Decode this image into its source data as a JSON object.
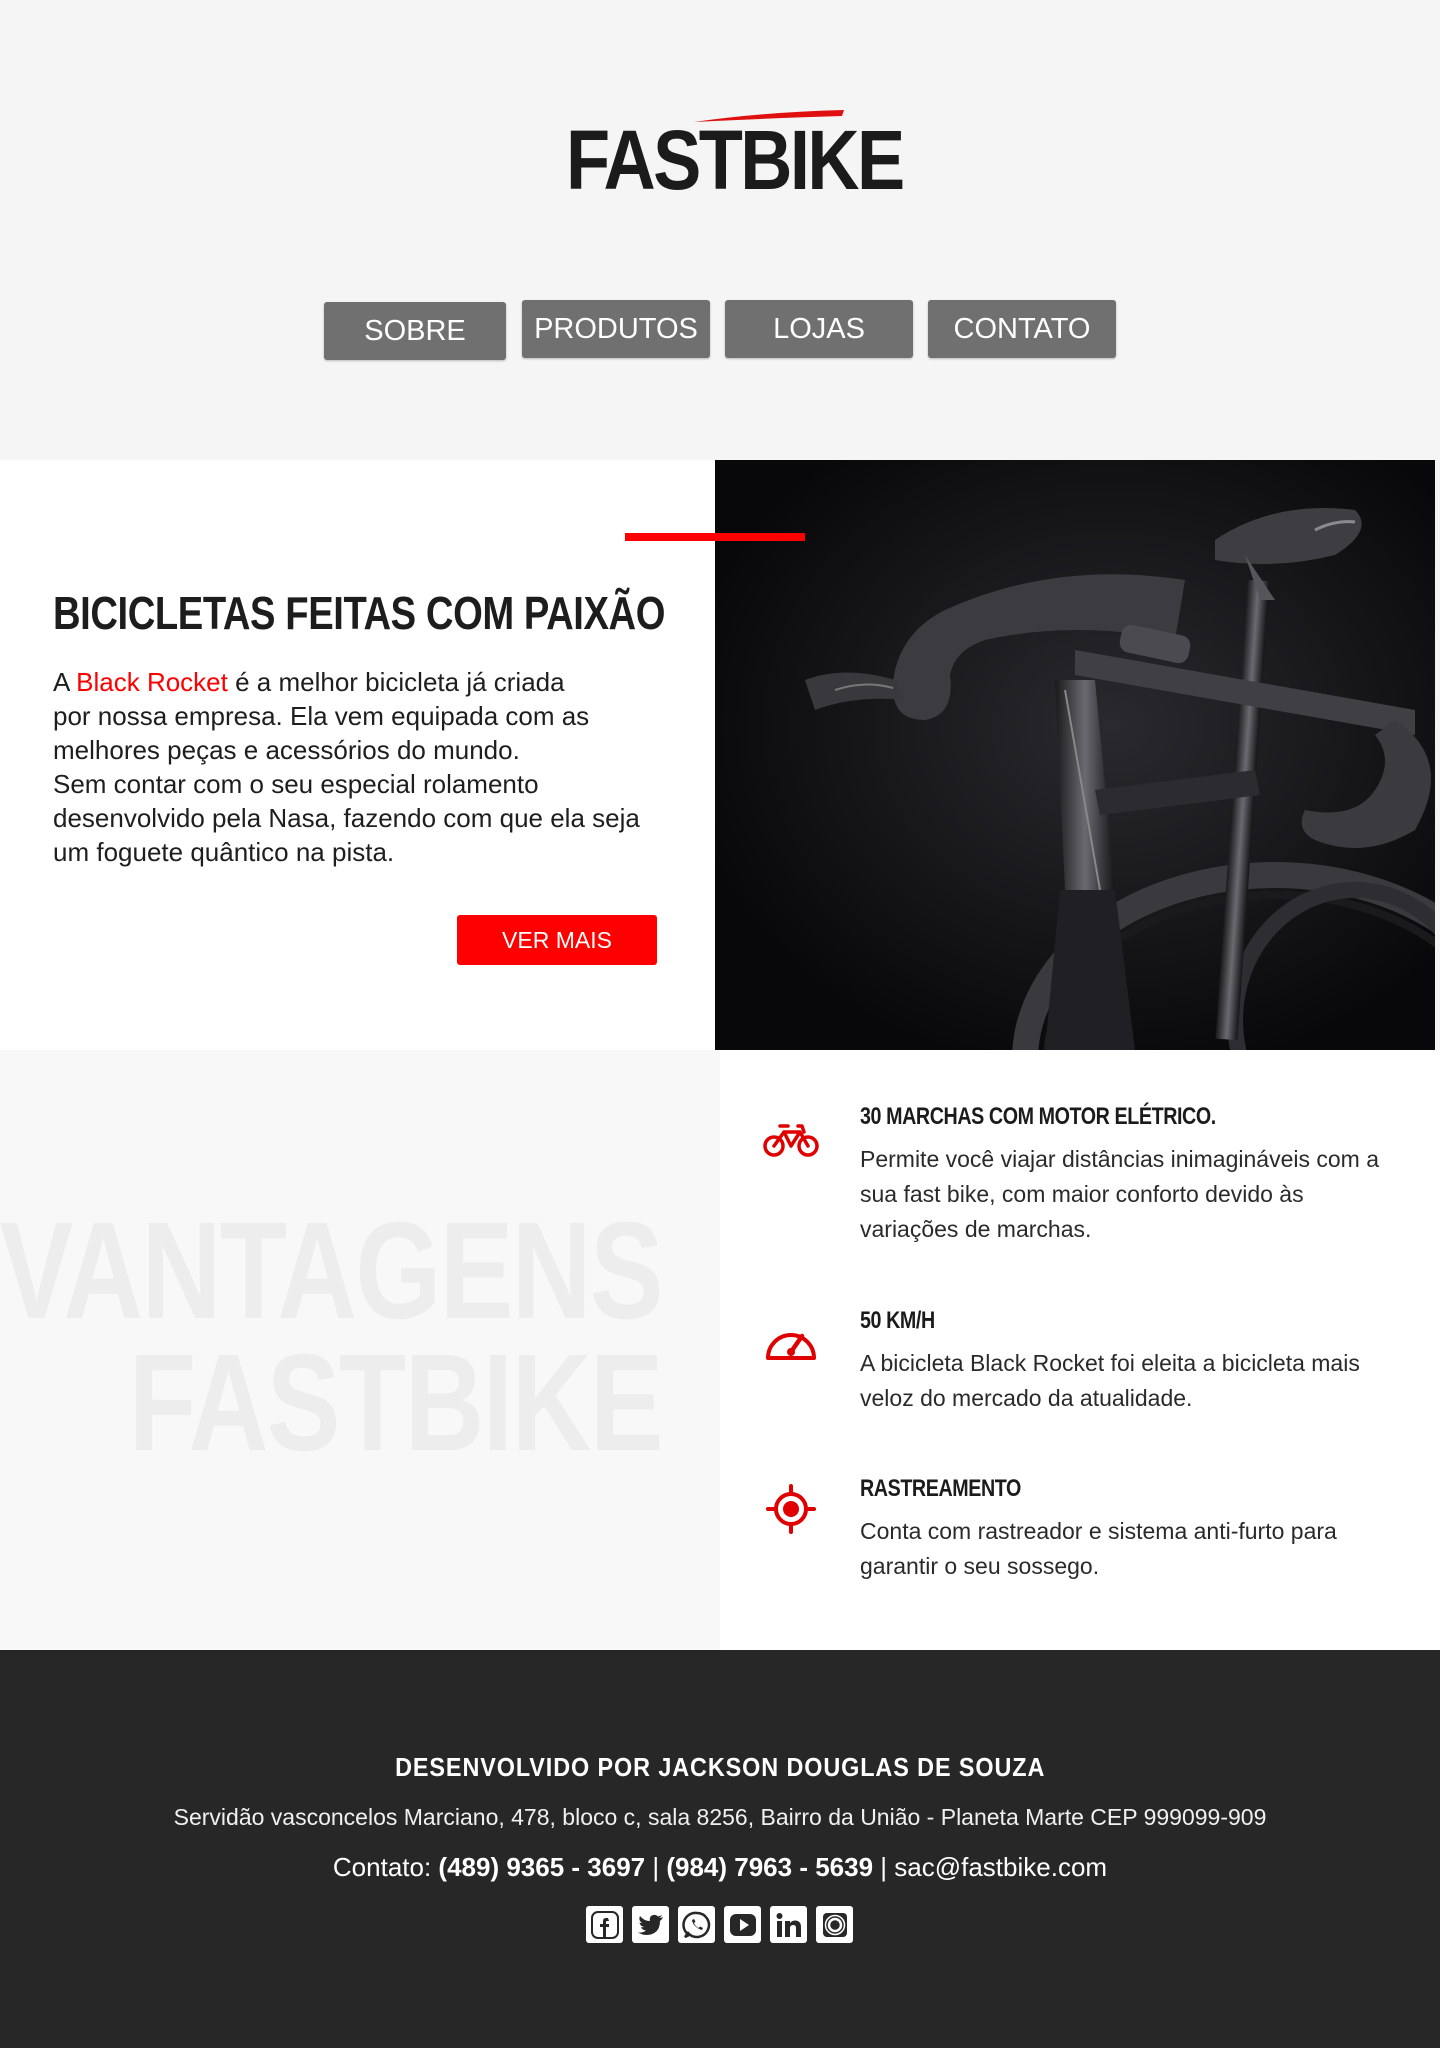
{
  "brand": {
    "logo_text": "FASTBIKE",
    "accent_color": "#ff0000",
    "dark_color": "#1b1b1b"
  },
  "nav": {
    "items": [
      {
        "label": "SOBRE"
      },
      {
        "label": "PRODUTOS"
      },
      {
        "label": "LOJAS"
      },
      {
        "label": "CONTATO"
      }
    ]
  },
  "hero": {
    "title": "BICICLETAS FEITAS COM PAIXÃO",
    "text_prefix": "A ",
    "text_highlight": "Black Rocket",
    "text_line1_rest": " é a melhor bicicleta já criada",
    "text_line2": "por nossa empresa. Ela vem equipada com as",
    "text_line3": "melhores peças e acessórios do mundo.",
    "text_line4": "Sem contar com o seu especial rolamento",
    "text_line5": "desenvolvido pela Nasa, fazendo com que ela seja",
    "text_line6": "um foguete quântico na pista.",
    "button_label": "VER MAIS",
    "image_alt": "bike-photo"
  },
  "advantages": {
    "watermark_line1": "VANTAGENS",
    "watermark_line2": "FASTBIKE",
    "features": [
      {
        "icon": "bicycle-icon",
        "title": "30 MARCHAS COM MOTOR ELÉTRICO.",
        "description": "Permite você viajar distâncias inimagináveis com a sua fast bike, com maior conforto devido às variações de marchas."
      },
      {
        "icon": "speedometer-icon",
        "title": "50 KM/H",
        "description": "A bicicleta Black Rocket foi eleita a bicicleta mais veloz do mercado da atualidade."
      },
      {
        "icon": "target-icon",
        "title": "RASTREAMENTO",
        "description": "Conta com rastreador e sistema anti-furto para garantir o seu sossego."
      }
    ]
  },
  "footer": {
    "title": "DESENVOLVIDO POR JACKSON DOUGLAS DE SOUZA",
    "address": "Servidão vasconcelos Marciano, 478, bloco c, sala 8256, Bairro da União - Planeta Marte CEP 999099-909",
    "contact_label": "Contato: ",
    "phone1": "(489) 9365 - 3697",
    "separator": " | ",
    "phone2": "(984) 7963 - 5639",
    "email": "sac@fastbike.com",
    "socials": [
      "facebook-icon",
      "twitter-icon",
      "whatsapp-icon",
      "youtube-icon",
      "linkedin-icon",
      "instagram-icon"
    ]
  }
}
